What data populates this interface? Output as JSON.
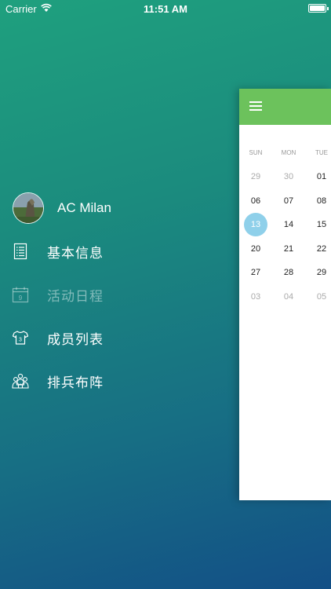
{
  "status_bar": {
    "carrier": "Carrier",
    "time": "11:51 AM"
  },
  "profile": {
    "name": "AC Milan"
  },
  "menu": [
    {
      "label": "基本信息",
      "icon": "document-list-icon",
      "active": true
    },
    {
      "label": "活动日程",
      "icon": "calendar-icon",
      "active": false,
      "icon_text": "9"
    },
    {
      "label": "成员列表",
      "icon": "jersey-icon",
      "active": true,
      "icon_text": "3"
    },
    {
      "label": "排兵布阵",
      "icon": "team-group-icon",
      "active": true
    }
  ],
  "calendar": {
    "weekdays": [
      "SUN",
      "MON",
      "TUE"
    ],
    "weeks": [
      [
        "29",
        "30",
        "01"
      ],
      [
        "06",
        "07",
        "08"
      ],
      [
        "13",
        "14",
        "15"
      ],
      [
        "20",
        "21",
        "22"
      ],
      [
        "27",
        "28",
        "29"
      ],
      [
        "03",
        "04",
        "05"
      ]
    ],
    "muted": [
      [
        0,
        0
      ],
      [
        0,
        1
      ],
      [
        5,
        0
      ],
      [
        5,
        1
      ],
      [
        5,
        2
      ]
    ],
    "selected": [
      2,
      0
    ]
  },
  "colors": {
    "header_green": "#6cc25c",
    "selected_day": "#8fd0ea"
  }
}
